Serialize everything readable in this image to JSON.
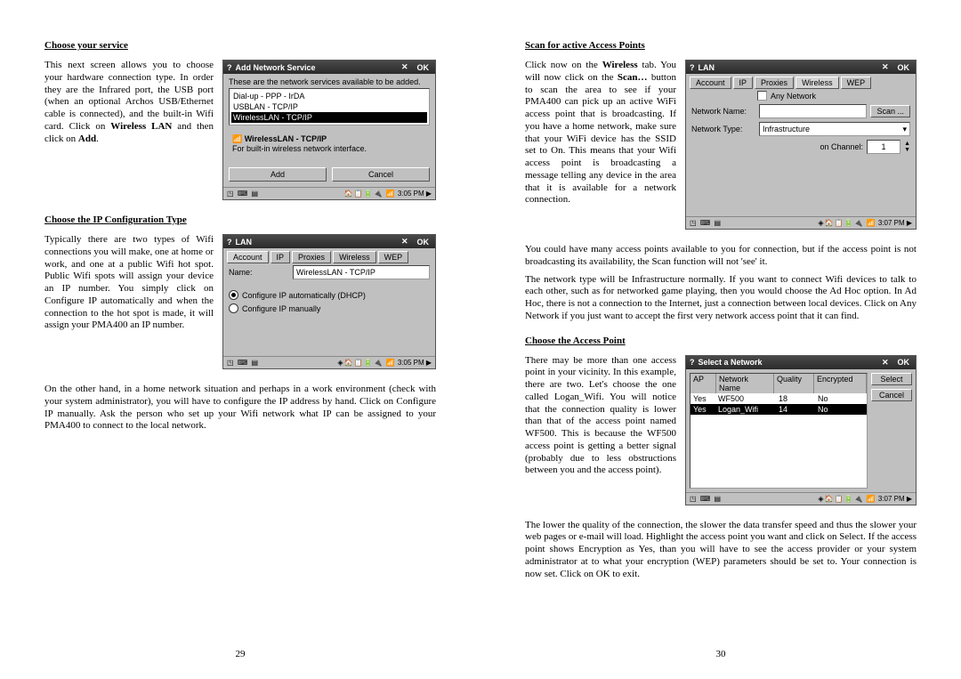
{
  "left": {
    "h1": "Choose your service",
    "p1_a": "This next screen allows you to choose your hardware connection type. In order they are the Infrared port, the USB port (when an optional Archos USB/Ethernet cable is connected), and the built-in Wifi card. Click on ",
    "p1_bold1": "Wireless LAN",
    "p1_b": " and then click on ",
    "p1_bold2": "Add",
    "p1_c": ".",
    "shot1": {
      "title": "Add Network Service",
      "x": "✕",
      "ok": "OK",
      "instr": "These are the network services available to be added.",
      "svc1": "Dial-up - PPP - IrDA",
      "svc2": "USBLAN - TCP/IP",
      "svc3": "WirelessLAN - TCP/IP",
      "sub_title": "WirelessLAN - TCP/IP",
      "sub_desc": "For built-in wireless network interface.",
      "btn_add": "Add",
      "btn_cancel": "Cancel",
      "time": "3:05 PM"
    },
    "h2": "Choose the IP Configuration Type",
    "p2": "Typically there are two types of Wifi connections you will make, one at home or work, and one at a public Wifi hot spot. Public Wifi spots will assign your device an IP number. You simply click on Configure IP automatically and when the connection to the hot spot is made, it will assign your PMA400 an IP number.",
    "shot2": {
      "title": "LAN",
      "x": "✕",
      "ok": "OK",
      "tab1": "Account",
      "tab2": "IP",
      "tab3": "Proxies",
      "tab4": "Wireless",
      "tab5": "WEP",
      "name_label": "Name:",
      "name_val": "WirelessLAN - TCP/IP",
      "r1": "Configure IP automatically (DHCP)",
      "r2": "Configure IP manually",
      "time": "3:05 PM"
    },
    "p3": "On the other hand, in a home network situation and perhaps in a work environment (check with your system administrator), you will have to configure the IP address by hand. Click on Configure IP manually. Ask the person who set up your Wifi network what IP can be assigned to your PMA400 to connect to the local network.",
    "pagenum": "29"
  },
  "right": {
    "h1": "Scan for active Access Points",
    "p1_a": "Click now on the ",
    "p1_bold1": "Wireless",
    "p1_b": " tab. You will now click on the ",
    "p1_bold2": "Scan…",
    "p1_c": " button to scan the area to see if your PMA400 can pick up an active WiFi access point that is broadcasting. If you have a home network, make sure that your WiFi device has the SSID set to On. This means that your Wifi access point is broadcasting a message telling any device in the area that it is available for a network connection.",
    "shot1": {
      "title": "LAN",
      "x": "✕",
      "ok": "OK",
      "tab1": "Account",
      "tab2": "IP",
      "tab3": "Proxies",
      "tab4": "Wireless",
      "tab5": "WEP",
      "any": "Any Network",
      "nm_label": "Network Name:",
      "nm_val": "",
      "scan_btn": "Scan ...",
      "type_label": "Network Type:",
      "type_val": "Infrastructure",
      "ch_label": "on Channel:",
      "ch_val": "1",
      "time": "3:07 PM"
    },
    "p2": "  You could have many access points available to you for connection, but if the access point is not broadcasting its availability, the Scan function will not 'see' it.",
    "p3_a": "  The network type will be ",
    "p3_bold1": "Infrastructure",
    "p3_b": " normally. If you want to connect Wifi devices to talk to each other, such as for networked game playing, then you would choose the ",
    "p3_bold2": "Ad Hoc",
    "p3_c": " option. In ",
    "p3_bold3": "Ad Hoc",
    "p3_d": ", there is not a connection to the Internet, just a connection between local devices. Click on ",
    "p3_bold4": "Any Network",
    "p3_e": " if you just want to accept the first very network access point that it can find.",
    "h2": "Choose the Access Point",
    "p4": "There may be more than one access point in your vicinity. In this example, there are two. Let's choose the one called Logan_Wifi. You will notice that the connection quality is lower than that of the access point named WF500. This is because the WF500 access point is getting a better signal (probably due to less obstructions between you and the access point).",
    "shot2": {
      "title": "Select a Network",
      "x": "✕",
      "ok": "OK",
      "col_ap": "AP",
      "col_nm": "Network Name",
      "col_q": "Quality",
      "col_e": "Encrypted",
      "r1_ap": "Yes",
      "r1_nm": "WF500",
      "r1_q": "18",
      "r1_e": "No",
      "r2_ap": "Yes",
      "r2_nm": "Logan_Wifi",
      "r2_q": "14",
      "r2_e": "No",
      "btn_select": "Select",
      "btn_cancel": "Cancel",
      "time": "3:07 PM"
    },
    "p5_a": "The lower the quality of the connection, the slower the data transfer speed and thus the slower your web pages or e-mail will load. Highlight the access point you want and click on ",
    "p5_bold1": "Select",
    "p5_b": ". If the access point shows ",
    "p5_bold2": "Encryption",
    "p5_c": " as ",
    "p5_bold3": "Yes",
    "p5_d": ", than you will have to see the access provider or your system administrator at to what your encryption (WEP) parameters should be set to. Your connection is now set. Click on ",
    "p5_bold4": "OK",
    "p5_e": " to exit.",
    "pagenum": "30"
  }
}
